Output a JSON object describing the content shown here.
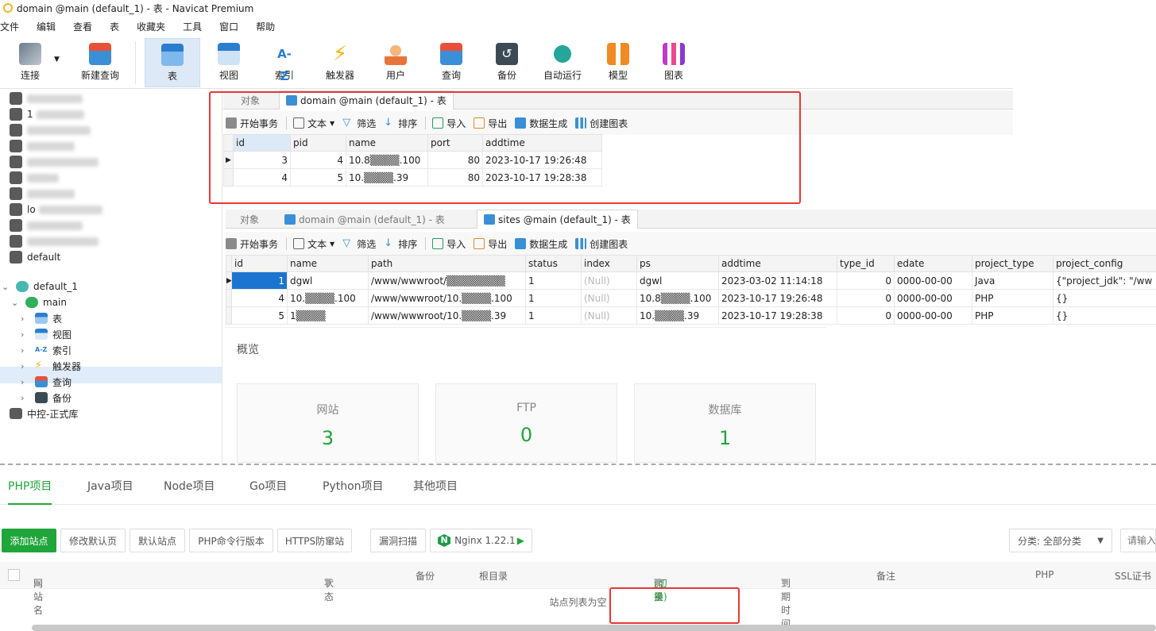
{
  "window": {
    "title": "domain @main (default_1) - 表 - Navicat Premium"
  },
  "menu": [
    "文件",
    "编辑",
    "查看",
    "表",
    "收藏夹",
    "工具",
    "窗口",
    "帮助"
  ],
  "toolbar": [
    {
      "label": "连接",
      "icon": "connect-icon"
    },
    {
      "label": "新建查询",
      "icon": "new-query-icon"
    },
    {
      "label": "表",
      "icon": "table-icon"
    },
    {
      "label": "视图",
      "icon": "view-icon"
    },
    {
      "label": "索引",
      "icon": "index-icon",
      "glyph": "A-Z"
    },
    {
      "label": "触发器",
      "icon": "trigger-icon"
    },
    {
      "label": "用户",
      "icon": "user-icon"
    },
    {
      "label": "查询",
      "icon": "query-icon"
    },
    {
      "label": "备份",
      "icon": "backup-icon"
    },
    {
      "label": "自动运行",
      "icon": "automation-icon"
    },
    {
      "label": "模型",
      "icon": "model-icon"
    },
    {
      "label": "图表",
      "icon": "chart-icon"
    }
  ],
  "sidebar": {
    "partial_labels": [
      "1",
      "lo",
      "default"
    ],
    "selected_connection": "default_1",
    "database": "main",
    "nodes": [
      "表",
      "视图",
      "索引",
      "触发器",
      "查询",
      "备份"
    ],
    "last_connection": "中控-正式库"
  },
  "editor1": {
    "tabs": [
      "对象",
      "domain @main (default_1) - 表"
    ],
    "subtoolbar": {
      "begin": "开始事务",
      "text": "文本",
      "filter": "筛选",
      "sort": "排序",
      "import": "导入",
      "export": "导出",
      "gen": "数据生成",
      "chart": "创建图表"
    },
    "columns": [
      "id",
      "pid",
      "name",
      "port",
      "addtime"
    ],
    "rows": [
      {
        "id": "3",
        "pid": "4",
        "name": "10.8▒▒▒▒.100",
        "port": "80",
        "addtime": "2023-10-17 19:26:48"
      },
      {
        "id": "4",
        "pid": "5",
        "name": "10.▒▒▒▒.39",
        "port": "80",
        "addtime": "2023-10-17 19:28:38"
      }
    ]
  },
  "editor2": {
    "tabs": [
      "对象",
      "domain @main (default_1) - 表",
      "sites @main (default_1) - 表"
    ],
    "columns": [
      "id",
      "name",
      "path",
      "status",
      "index",
      "ps",
      "addtime",
      "type_id",
      "edate",
      "project_type",
      "project_config"
    ],
    "rows": [
      {
        "id": "1",
        "name": "dgwl",
        "path": "/www/wwwroot/▒▒▒▒▒▒▒▒",
        "status": "1",
        "index": "(Null)",
        "ps": "dgwl",
        "addtime": "2023-03-02 11:14:18",
        "type_id": "0",
        "edate": "0000-00-00",
        "project_type": "Java",
        "project_config": "{\"project_jdk\": \"/ww"
      },
      {
        "id": "4",
        "name": "10.▒▒▒▒.100",
        "path": "/www/wwwroot/10.▒▒▒▒.100",
        "status": "1",
        "index": "(Null)",
        "ps": "10.8▒▒▒▒.100",
        "addtime": "2023-10-17 19:26:48",
        "type_id": "0",
        "edate": "0000-00-00",
        "project_type": "PHP",
        "project_config": "{}"
      },
      {
        "id": "5",
        "name": "1▒▒▒▒",
        "path": "/www/wwwroot/10.▒▒▒▒.39",
        "status": "1",
        "index": "(Null)",
        "ps": "10.▒▒▒▒.39",
        "addtime": "2023-10-17 19:28:38",
        "type_id": "0",
        "edate": "0000-00-00",
        "project_type": "PHP",
        "project_config": "{}"
      }
    ]
  },
  "overview": {
    "title": "概览",
    "cards": [
      {
        "label": "网站",
        "value": "3"
      },
      {
        "label": "FTP",
        "value": "0"
      },
      {
        "label": "数据库",
        "value": "1"
      }
    ]
  },
  "panel": {
    "tabs": [
      "PHP项目",
      "Java项目",
      "Node项目",
      "Go项目",
      "Python项目",
      "其他项目"
    ],
    "buttons": [
      "添加站点",
      "修改默认页",
      "默认站点",
      "PHP命令行版本",
      "HTTPS防窜站",
      "漏洞扫描",
      "Nginx 1.22.1"
    ],
    "category_label": "分类: 全部分类",
    "search_placeholder": "请输入",
    "headers": {
      "site": "网站名",
      "status": "状态",
      "backup": "备份",
      "root": "根目录",
      "traffic": "流量",
      "switch": "(切换)",
      "expire": "到期时间",
      "note": "备注",
      "php": "PHP",
      "ssl": "SSL证书"
    },
    "empty": "站点列表为空"
  },
  "colors": {
    "accent": "#20a53a",
    "selection": "#1b75d0",
    "highlight": "#e53935"
  }
}
